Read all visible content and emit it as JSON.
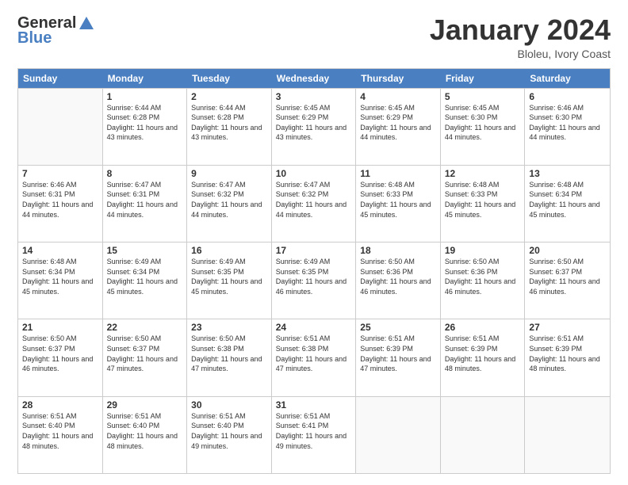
{
  "logo": {
    "general": "General",
    "blue": "Blue"
  },
  "header": {
    "month": "January 2024",
    "location": "Bloleu, Ivory Coast"
  },
  "weekdays": [
    "Sunday",
    "Monday",
    "Tuesday",
    "Wednesday",
    "Thursday",
    "Friday",
    "Saturday"
  ],
  "weeks": [
    [
      {
        "day": "",
        "empty": true
      },
      {
        "day": "1",
        "sunrise": "Sunrise: 6:44 AM",
        "sunset": "Sunset: 6:28 PM",
        "daylight": "Daylight: 11 hours and 43 minutes."
      },
      {
        "day": "2",
        "sunrise": "Sunrise: 6:44 AM",
        "sunset": "Sunset: 6:28 PM",
        "daylight": "Daylight: 11 hours and 43 minutes."
      },
      {
        "day": "3",
        "sunrise": "Sunrise: 6:45 AM",
        "sunset": "Sunset: 6:29 PM",
        "daylight": "Daylight: 11 hours and 43 minutes."
      },
      {
        "day": "4",
        "sunrise": "Sunrise: 6:45 AM",
        "sunset": "Sunset: 6:29 PM",
        "daylight": "Daylight: 11 hours and 44 minutes."
      },
      {
        "day": "5",
        "sunrise": "Sunrise: 6:45 AM",
        "sunset": "Sunset: 6:30 PM",
        "daylight": "Daylight: 11 hours and 44 minutes."
      },
      {
        "day": "6",
        "sunrise": "Sunrise: 6:46 AM",
        "sunset": "Sunset: 6:30 PM",
        "daylight": "Daylight: 11 hours and 44 minutes."
      }
    ],
    [
      {
        "day": "7",
        "sunrise": "Sunrise: 6:46 AM",
        "sunset": "Sunset: 6:31 PM",
        "daylight": "Daylight: 11 hours and 44 minutes."
      },
      {
        "day": "8",
        "sunrise": "Sunrise: 6:47 AM",
        "sunset": "Sunset: 6:31 PM",
        "daylight": "Daylight: 11 hours and 44 minutes."
      },
      {
        "day": "9",
        "sunrise": "Sunrise: 6:47 AM",
        "sunset": "Sunset: 6:32 PM",
        "daylight": "Daylight: 11 hours and 44 minutes."
      },
      {
        "day": "10",
        "sunrise": "Sunrise: 6:47 AM",
        "sunset": "Sunset: 6:32 PM",
        "daylight": "Daylight: 11 hours and 44 minutes."
      },
      {
        "day": "11",
        "sunrise": "Sunrise: 6:48 AM",
        "sunset": "Sunset: 6:33 PM",
        "daylight": "Daylight: 11 hours and 45 minutes."
      },
      {
        "day": "12",
        "sunrise": "Sunrise: 6:48 AM",
        "sunset": "Sunset: 6:33 PM",
        "daylight": "Daylight: 11 hours and 45 minutes."
      },
      {
        "day": "13",
        "sunrise": "Sunrise: 6:48 AM",
        "sunset": "Sunset: 6:34 PM",
        "daylight": "Daylight: 11 hours and 45 minutes."
      }
    ],
    [
      {
        "day": "14",
        "sunrise": "Sunrise: 6:48 AM",
        "sunset": "Sunset: 6:34 PM",
        "daylight": "Daylight: 11 hours and 45 minutes."
      },
      {
        "day": "15",
        "sunrise": "Sunrise: 6:49 AM",
        "sunset": "Sunset: 6:34 PM",
        "daylight": "Daylight: 11 hours and 45 minutes."
      },
      {
        "day": "16",
        "sunrise": "Sunrise: 6:49 AM",
        "sunset": "Sunset: 6:35 PM",
        "daylight": "Daylight: 11 hours and 45 minutes."
      },
      {
        "day": "17",
        "sunrise": "Sunrise: 6:49 AM",
        "sunset": "Sunset: 6:35 PM",
        "daylight": "Daylight: 11 hours and 46 minutes."
      },
      {
        "day": "18",
        "sunrise": "Sunrise: 6:50 AM",
        "sunset": "Sunset: 6:36 PM",
        "daylight": "Daylight: 11 hours and 46 minutes."
      },
      {
        "day": "19",
        "sunrise": "Sunrise: 6:50 AM",
        "sunset": "Sunset: 6:36 PM",
        "daylight": "Daylight: 11 hours and 46 minutes."
      },
      {
        "day": "20",
        "sunrise": "Sunrise: 6:50 AM",
        "sunset": "Sunset: 6:37 PM",
        "daylight": "Daylight: 11 hours and 46 minutes."
      }
    ],
    [
      {
        "day": "21",
        "sunrise": "Sunrise: 6:50 AM",
        "sunset": "Sunset: 6:37 PM",
        "daylight": "Daylight: 11 hours and 46 minutes."
      },
      {
        "day": "22",
        "sunrise": "Sunrise: 6:50 AM",
        "sunset": "Sunset: 6:37 PM",
        "daylight": "Daylight: 11 hours and 47 minutes."
      },
      {
        "day": "23",
        "sunrise": "Sunrise: 6:50 AM",
        "sunset": "Sunset: 6:38 PM",
        "daylight": "Daylight: 11 hours and 47 minutes."
      },
      {
        "day": "24",
        "sunrise": "Sunrise: 6:51 AM",
        "sunset": "Sunset: 6:38 PM",
        "daylight": "Daylight: 11 hours and 47 minutes."
      },
      {
        "day": "25",
        "sunrise": "Sunrise: 6:51 AM",
        "sunset": "Sunset: 6:39 PM",
        "daylight": "Daylight: 11 hours and 47 minutes."
      },
      {
        "day": "26",
        "sunrise": "Sunrise: 6:51 AM",
        "sunset": "Sunset: 6:39 PM",
        "daylight": "Daylight: 11 hours and 48 minutes."
      },
      {
        "day": "27",
        "sunrise": "Sunrise: 6:51 AM",
        "sunset": "Sunset: 6:39 PM",
        "daylight": "Daylight: 11 hours and 48 minutes."
      }
    ],
    [
      {
        "day": "28",
        "sunrise": "Sunrise: 6:51 AM",
        "sunset": "Sunset: 6:40 PM",
        "daylight": "Daylight: 11 hours and 48 minutes."
      },
      {
        "day": "29",
        "sunrise": "Sunrise: 6:51 AM",
        "sunset": "Sunset: 6:40 PM",
        "daylight": "Daylight: 11 hours and 48 minutes."
      },
      {
        "day": "30",
        "sunrise": "Sunrise: 6:51 AM",
        "sunset": "Sunset: 6:40 PM",
        "daylight": "Daylight: 11 hours and 49 minutes."
      },
      {
        "day": "31",
        "sunrise": "Sunrise: 6:51 AM",
        "sunset": "Sunset: 6:41 PM",
        "daylight": "Daylight: 11 hours and 49 minutes."
      },
      {
        "day": "",
        "empty": true
      },
      {
        "day": "",
        "empty": true
      },
      {
        "day": "",
        "empty": true
      }
    ]
  ]
}
